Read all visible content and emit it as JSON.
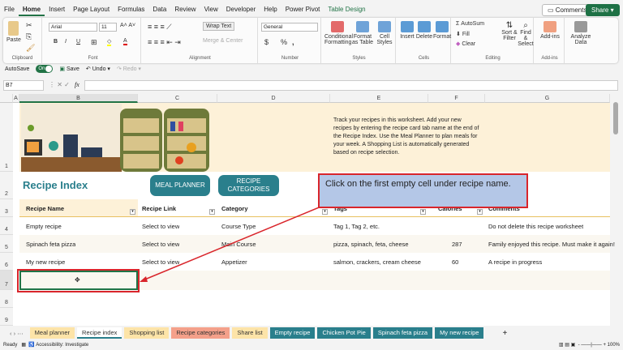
{
  "menu": [
    "File",
    "Home",
    "Insert",
    "Page Layout",
    "Formulas",
    "Data",
    "Review",
    "View",
    "Developer",
    "Help",
    "Power Pivot",
    "Table Design"
  ],
  "top_buttons": {
    "comments": "Comments",
    "share": "Share"
  },
  "ribbon": {
    "clipboard": {
      "paste": "Paste",
      "label": "Clipboard"
    },
    "font": {
      "name": "Arial",
      "size": "11",
      "bold": "B",
      "italic": "I",
      "underline": "U",
      "label": "Font"
    },
    "alignment": {
      "wrap": "Wrap Text",
      "merge": "Merge & Center",
      "label": "Alignment"
    },
    "number": {
      "format": "General",
      "currency": "$",
      "percent": "%",
      "comma": ",",
      "label": "Number"
    },
    "styles": {
      "conditional": "Conditional Formatting",
      "format_table": "Format as Table",
      "cell_styles": "Cell Styles",
      "label": "Styles"
    },
    "cells": {
      "insert": "Insert",
      "delete": "Delete",
      "format": "Format",
      "label": "Cells"
    },
    "editing": {
      "autosum": "AutoSum",
      "fill": "Fill",
      "clear": "Clear",
      "sort": "Sort & Filter",
      "find": "Find & Select",
      "label": "Editing"
    },
    "addins": {
      "addins": "Add-ins",
      "label": "Add-ins"
    },
    "analyze": {
      "label": "Analyze Data"
    }
  },
  "qat": {
    "autosave": "AutoSave",
    "toggle": "On",
    "save": "Save",
    "undo": "Undo",
    "redo": "Redo"
  },
  "formula_bar": {
    "name_box": "B7",
    "fx": "fx",
    "value": ""
  },
  "columns": [
    "A",
    "B",
    "C",
    "D",
    "E",
    "F",
    "G"
  ],
  "rows": [
    "1",
    "2",
    "3",
    "4",
    "5",
    "6",
    "7",
    "8",
    "9"
  ],
  "banner_text": "Track your recipes in this worksheet. Add your new recipes by entering the recipe card tab name at the end of the Recipe Index. Use the Meal Planner to plan meals for your week. A Shopping List is automatically generated based on recipe selection.",
  "title": "Recipe Index",
  "buttons": {
    "meal_planner": "MEAL PLANNER",
    "recipe_categories": "RECIPE CATEGORIES"
  },
  "table": {
    "headers": [
      "Recipe Name",
      "Recipe Link",
      "Category",
      "Tags",
      "Calories",
      "Comments"
    ],
    "rows": [
      [
        "Empty recipe",
        "Select to view",
        "Course Type",
        "Tag 1, Tag 2, etc.",
        "",
        "Do not delete this recipe worksheet"
      ],
      [
        "Spinach feta pizza",
        "Select to view",
        "Main Course",
        "pizza, spinach, feta, cheese",
        "287",
        "Family enjoyed this recipe. Must make it again!"
      ],
      [
        "My new recipe",
        "Select to view",
        "Appetizer",
        "salmon, crackers, cream cheese",
        "60",
        "A recipe in progress"
      ]
    ]
  },
  "callout": "Click on the first empty cell under recipe name.",
  "sheet_tabs": [
    {
      "label": "Meal planner",
      "color": "#fde4a8"
    },
    {
      "label": "Recipe index",
      "color": "#d9eef0",
      "active": true
    },
    {
      "label": "Shopping list",
      "color": "#fde4a8"
    },
    {
      "label": "Recipe categories",
      "color": "#f4a08a"
    },
    {
      "label": "Share list",
      "color": "#fde4a8"
    },
    {
      "label": "Empty recipe",
      "color": "#2a7f8c"
    },
    {
      "label": "Chicken Pot Pie",
      "color": "#2a7f8c"
    },
    {
      "label": "Spinach feta pizza",
      "color": "#2a7f8c"
    },
    {
      "label": "My new recipe",
      "color": "#2a7f8c"
    }
  ],
  "status": {
    "ready": "Ready",
    "accessibility": "Accessibility: Investigate",
    "zoom": "100%"
  },
  "colors": {
    "accent": "#217346",
    "teal": "#2a7f8c",
    "banner": "#fdf1d8",
    "callout_bg": "#b4c7e7",
    "callout_border": "#d9252b"
  }
}
